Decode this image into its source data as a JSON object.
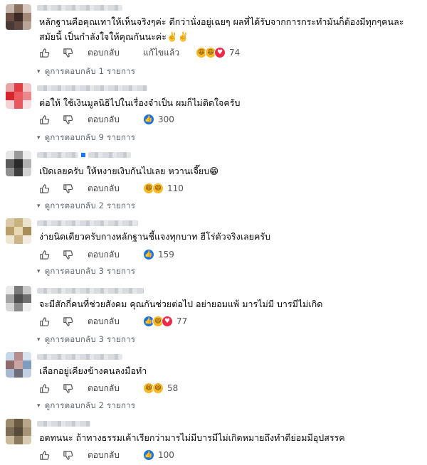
{
  "labels": {
    "reply": "ตอบกลับ",
    "edited": "แก้ไขแล้ว"
  },
  "comments": [
    {
      "text_lines": [
        "หลักฐานคือคุณเทาให้เห็นจริงๆค่ะ ดีกว่านั่งอยู่เฉยๆ ผลที่ได้รับจากการกระทำมันก็ต้องมีทุกๆคนละ",
        "สมัยนี้ เป็นกำลังใจให้คุณกันนะค่ะ✌️✌️"
      ],
      "edited": true,
      "reactions": [
        "haha",
        "haha",
        "love"
      ],
      "reaction_count": "74",
      "replies": "ดูการตอบกลับ 1 รายการ"
    },
    {
      "text_lines": [
        "ต่อให้ ใช้เงินมูลนิธิไปในเรื่องจำเป็น ผมก็ไม่ติดใจครับ"
      ],
      "edited": false,
      "reactions": [
        "like"
      ],
      "reaction_count": "300",
      "replies": "ดูการตอบกลับ 9 รายการ"
    },
    {
      "text_lines": [
        "เปิดเลยครับ ให้หงายเงิบกันไปเลย หวานเจี๊ยบ😁"
      ],
      "edited": false,
      "reactions": [
        "haha",
        "haha"
      ],
      "reaction_count": "110",
      "replies": "ดูการตอบกลับ 2 รายการ"
    },
    {
      "text_lines": [
        "ง่ายนิดเดียวครับกางหลักฐานชี้แจงทุกบาท ฮีโร่ตัวจริงเลยครับ"
      ],
      "edited": false,
      "reactions": [
        "like"
      ],
      "reaction_count": "159",
      "replies": "ดูการตอบกลับ 3 รายการ"
    },
    {
      "text_lines": [
        "จะมีสักกี่คนที่ช่วยสังคม คุณกันช่วยต่อไป อย่ายอมแพ้ มารไม่มี บารมีไม่เกิด"
      ],
      "edited": false,
      "reactions": [
        "like",
        "haha",
        "love"
      ],
      "reaction_count": "77",
      "replies": "ดูการตอบกลับ 3 รายการ"
    },
    {
      "text_lines": [
        "เลือกอยู่เคียงข้างคนลงมือทำ"
      ],
      "edited": false,
      "reactions": [
        "haha",
        "haha"
      ],
      "reaction_count": "58",
      "replies": "ดูการตอบกลับ 2 รายการ"
    },
    {
      "text_lines": [
        "อดทนนะ ถ้าทางธรรมเค้าเรียกว่ามารไม่มีบารมีไม่เกิดหมายถึงทำดีย่อมมีอุปสรรค"
      ],
      "edited": false,
      "reactions": [
        "like"
      ],
      "reaction_count": "100",
      "replies": ""
    }
  ]
}
